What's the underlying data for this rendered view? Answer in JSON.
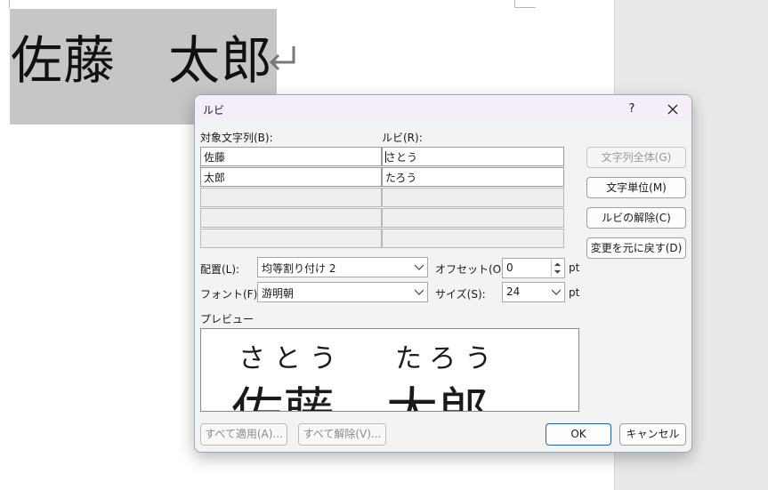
{
  "document": {
    "text": "佐藤　太郎"
  },
  "dialog": {
    "title": "ルビ",
    "help_label": "?",
    "target_label": "対象文字列(B):",
    "ruby_label": "ルビ(R):",
    "rows": [
      {
        "base": "佐藤",
        "ruby": "さとう"
      },
      {
        "base": "太郎",
        "ruby": "たろう"
      },
      {
        "base": "",
        "ruby": ""
      },
      {
        "base": "",
        "ruby": ""
      },
      {
        "base": "",
        "ruby": ""
      }
    ],
    "side_buttons": {
      "whole_string": "文字列全体(G)",
      "per_char": "文字単位(M)",
      "remove_ruby": "ルビの解除(C)",
      "restore": "変更を元に戻す(D)"
    },
    "alignment_label": "配置(L):",
    "alignment_value": "均等割り付け 2",
    "offset_label": "オフセット(O):",
    "offset_value": "0",
    "offset_unit": "pt",
    "font_label": "フォント(F):",
    "font_value": "游明朝",
    "size_label": "サイズ(S):",
    "size_value": "24",
    "size_unit": "pt",
    "preview_label": "プレビュー",
    "preview": {
      "ruby_1": "さとう",
      "ruby_2": "たろう",
      "base": "佐藤　太郎"
    },
    "apply_all": "すべて適用(A)...",
    "remove_all": "すべて解除(V)...",
    "ok": "OK",
    "cancel": "キャンセル"
  },
  "colors": {
    "selection": "#c6c6c6",
    "ok_border": "#1f5fbf",
    "disabled_text": "#9a9a9a"
  }
}
